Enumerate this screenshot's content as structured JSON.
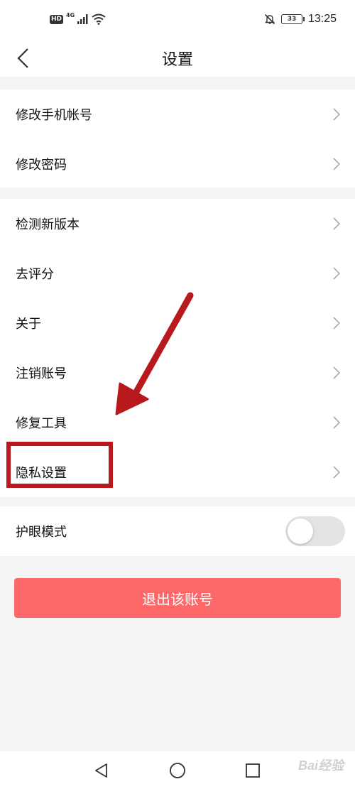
{
  "status_bar": {
    "hd": "HD",
    "network": "4G",
    "battery": "33",
    "time": "13:25",
    "icons": [
      "signal-icon",
      "wifi-icon",
      "mute-bell-icon",
      "battery-icon"
    ]
  },
  "header": {
    "title": "设置",
    "back_icon": "chevron-left-icon"
  },
  "groups": [
    {
      "items": [
        {
          "label": "修改手机帐号"
        },
        {
          "label": "修改密码"
        }
      ]
    },
    {
      "items": [
        {
          "label": "检测新版本"
        },
        {
          "label": "去评分"
        },
        {
          "label": "关于"
        },
        {
          "label": "注销账号"
        },
        {
          "label": "修复工具"
        },
        {
          "label": "隐私设置"
        }
      ]
    },
    {
      "items": [
        {
          "label": "护眼模式",
          "toggle": false
        }
      ]
    }
  ],
  "logout": {
    "label": "退出该账号"
  },
  "annotation": {
    "highlighted_item": "隐私设置",
    "color": "#b8191c"
  },
  "colors": {
    "logout_bg": "#ff6869",
    "page_bg": "#f5f5f5",
    "toggle_off": "#e3e3e3"
  },
  "bottom_nav": {
    "icons": [
      "back-triangle-icon",
      "home-circle-icon",
      "recent-square-icon"
    ]
  },
  "watermark": {
    "text": "Bai经验"
  }
}
